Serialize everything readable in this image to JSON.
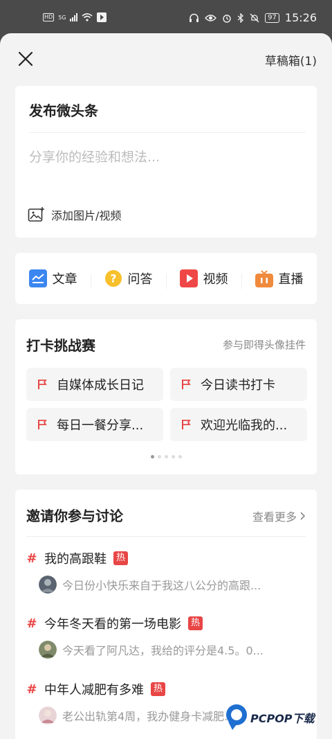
{
  "status_bar": {
    "time": "15:26",
    "battery": "97",
    "network_badge": "HD",
    "network_gen": "5G"
  },
  "header": {
    "close_icon": "close-icon",
    "drafts_label": "草稿箱(1)"
  },
  "compose": {
    "title": "发布微头条",
    "placeholder": "分享你的经验和想法...",
    "add_media_label": "添加图片/视频"
  },
  "post_types": [
    {
      "label": "文章",
      "icon": "article-icon",
      "color": "#3b86f0"
    },
    {
      "label": "问答",
      "icon": "question-icon",
      "color": "#f7c02c"
    },
    {
      "label": "视频",
      "icon": "video-icon",
      "color": "#ef4747"
    },
    {
      "label": "直播",
      "icon": "live-icon",
      "color": "#f08a3c"
    }
  ],
  "challenge": {
    "title": "打卡挑战赛",
    "subtitle": "参与即得头像挂件",
    "items": [
      {
        "label": "自媒体成长日记"
      },
      {
        "label": "今日读书打卡"
      },
      {
        "label": "每日一餐分享..."
      },
      {
        "label": "欢迎光临我的..."
      }
    ],
    "page_count": 5,
    "active_page": 1
  },
  "discussion": {
    "title": "邀请你参与讨论",
    "more_label": "查看更多",
    "hot_label": "热",
    "topics": [
      {
        "title": "我的高跟鞋",
        "preview": "今日份小快乐来自于我这八公分的高跟..."
      },
      {
        "title": "今年冬天看的第一场电影",
        "preview": "今天看了阿凡达，我给的评分是4.5。0..."
      },
      {
        "title": "中年人减肥有多难",
        "preview": "老公出轨第4周，我办健身卡减肥..."
      }
    ]
  },
  "watermark": {
    "text": "PCPOP下载"
  },
  "colors": {
    "accent_red": "#e84545",
    "background": "#f3f3f3"
  }
}
